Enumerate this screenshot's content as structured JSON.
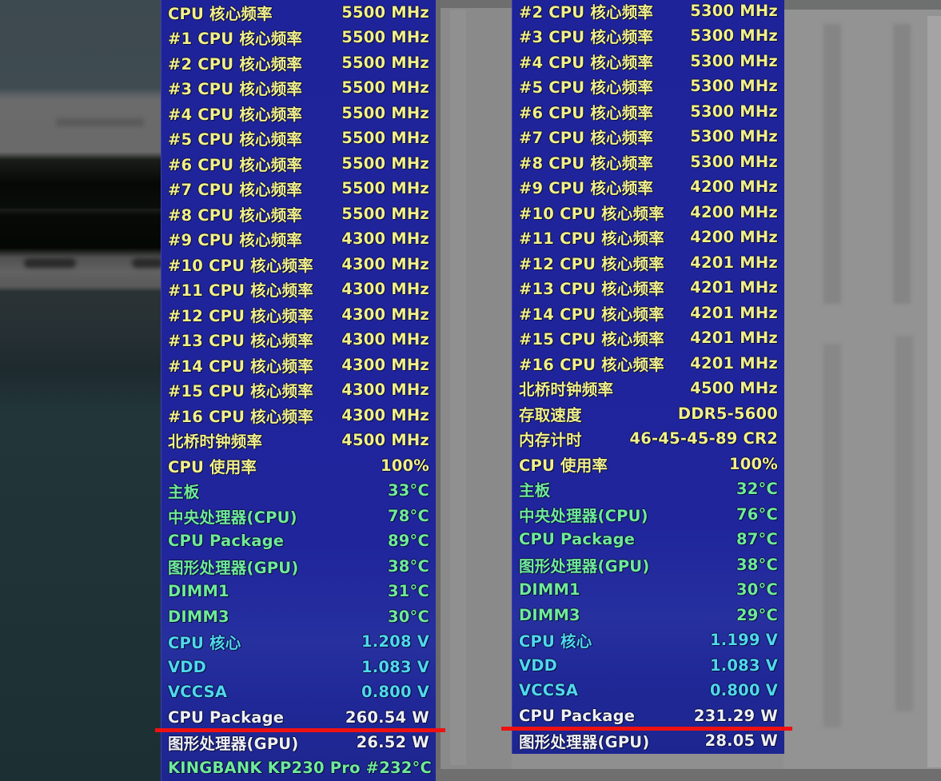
{
  "colors": {
    "panel_bg": "#1f239a",
    "frequency_text": "#f1f08a",
    "temperature_text": "#6fea9a",
    "voltage_text": "#4fd8ee",
    "power_text": "#eef0f4",
    "highlight_line": "#ee1111"
  },
  "left_panel": {
    "rows": [
      {
        "label": "CPU 核心频率",
        "value": "5500 MHz",
        "kind": "yellow"
      },
      {
        "label": "#1 CPU 核心频率",
        "value": "5500 MHz",
        "kind": "yellow"
      },
      {
        "label": "#2 CPU 核心频率",
        "value": "5500 MHz",
        "kind": "yellow"
      },
      {
        "label": "#3 CPU 核心频率",
        "value": "5500 MHz",
        "kind": "yellow"
      },
      {
        "label": "#4 CPU 核心频率",
        "value": "5500 MHz",
        "kind": "yellow"
      },
      {
        "label": "#5 CPU 核心频率",
        "value": "5500 MHz",
        "kind": "yellow"
      },
      {
        "label": "#6 CPU 核心频率",
        "value": "5500 MHz",
        "kind": "yellow"
      },
      {
        "label": "#7 CPU 核心频率",
        "value": "5500 MHz",
        "kind": "yellow"
      },
      {
        "label": "#8 CPU 核心频率",
        "value": "5500 MHz",
        "kind": "yellow"
      },
      {
        "label": "#9 CPU 核心频率",
        "value": "4300 MHz",
        "kind": "yellow"
      },
      {
        "label": "#10 CPU 核心频率",
        "value": "4300 MHz",
        "kind": "yellow"
      },
      {
        "label": "#11 CPU 核心频率",
        "value": "4300 MHz",
        "kind": "yellow"
      },
      {
        "label": "#12 CPU 核心频率",
        "value": "4300 MHz",
        "kind": "yellow"
      },
      {
        "label": "#13 CPU 核心频率",
        "value": "4300 MHz",
        "kind": "yellow"
      },
      {
        "label": "#14 CPU 核心频率",
        "value": "4300 MHz",
        "kind": "yellow"
      },
      {
        "label": "#15 CPU 核心频率",
        "value": "4300 MHz",
        "kind": "yellow"
      },
      {
        "label": "#16 CPU 核心频率",
        "value": "4300 MHz",
        "kind": "yellow"
      },
      {
        "label": "北桥时钟频率",
        "value": "4500 MHz",
        "kind": "yellow"
      },
      {
        "label": "CPU 使用率",
        "value": "100%",
        "kind": "yellow"
      },
      {
        "label": "主板",
        "value": "33°C",
        "kind": "green"
      },
      {
        "label": "中央处理器(CPU)",
        "value": "78°C",
        "kind": "green"
      },
      {
        "label": "CPU Package",
        "value": "89°C",
        "kind": "green"
      },
      {
        "label": "图形处理器(GPU)",
        "value": "38°C",
        "kind": "green"
      },
      {
        "label": "DIMM1",
        "value": "31°C",
        "kind": "green"
      },
      {
        "label": "DIMM3",
        "value": "30°C",
        "kind": "green"
      },
      {
        "label": "CPU 核心",
        "value": "1.208 V",
        "kind": "cyan"
      },
      {
        "label": "VDD",
        "value": "1.083 V",
        "kind": "cyan"
      },
      {
        "label": "VCCSA",
        "value": "0.800 V",
        "kind": "cyan"
      },
      {
        "label": "CPU Package",
        "value": "260.54 W",
        "kind": "white"
      },
      {
        "label": "图形处理器(GPU)",
        "value": "26.52 W",
        "kind": "white"
      },
      {
        "label": "KINGBANK KP230 Pro #2",
        "value": "32°C",
        "kind": "green"
      }
    ]
  },
  "right_panel": {
    "rows": [
      {
        "label": "#2 CPU 核心频率",
        "value": "5300 MHz",
        "kind": "yellow"
      },
      {
        "label": "#3 CPU 核心频率",
        "value": "5300 MHz",
        "kind": "yellow"
      },
      {
        "label": "#4 CPU 核心频率",
        "value": "5300 MHz",
        "kind": "yellow"
      },
      {
        "label": "#5 CPU 核心频率",
        "value": "5300 MHz",
        "kind": "yellow"
      },
      {
        "label": "#6 CPU 核心频率",
        "value": "5300 MHz",
        "kind": "yellow"
      },
      {
        "label": "#7 CPU 核心频率",
        "value": "5300 MHz",
        "kind": "yellow"
      },
      {
        "label": "#8 CPU 核心频率",
        "value": "5300 MHz",
        "kind": "yellow"
      },
      {
        "label": "#9 CPU 核心频率",
        "value": "4200 MHz",
        "kind": "yellow"
      },
      {
        "label": "#10 CPU 核心频率",
        "value": "4200 MHz",
        "kind": "yellow"
      },
      {
        "label": "#11 CPU 核心频率",
        "value": "4200 MHz",
        "kind": "yellow"
      },
      {
        "label": "#12 CPU 核心频率",
        "value": "4201 MHz",
        "kind": "yellow"
      },
      {
        "label": "#13 CPU 核心频率",
        "value": "4201 MHz",
        "kind": "yellow"
      },
      {
        "label": "#14 CPU 核心频率",
        "value": "4201 MHz",
        "kind": "yellow"
      },
      {
        "label": "#15 CPU 核心频率",
        "value": "4201 MHz",
        "kind": "yellow"
      },
      {
        "label": "#16 CPU 核心频率",
        "value": "4201 MHz",
        "kind": "yellow"
      },
      {
        "label": "北桥时钟频率",
        "value": "4500 MHz",
        "kind": "yellow"
      },
      {
        "label": "存取速度",
        "value": "DDR5-5600",
        "kind": "yellow"
      },
      {
        "label": "内存计时",
        "value": "46-45-45-89 CR2",
        "kind": "yellow"
      },
      {
        "label": "CPU 使用率",
        "value": "100%",
        "kind": "yellow"
      },
      {
        "label": "主板",
        "value": "32°C",
        "kind": "green"
      },
      {
        "label": "中央处理器(CPU)",
        "value": "76°C",
        "kind": "green"
      },
      {
        "label": "CPU Package",
        "value": "87°C",
        "kind": "green"
      },
      {
        "label": "图形处理器(GPU)",
        "value": "38°C",
        "kind": "green"
      },
      {
        "label": "DIMM1",
        "value": "30°C",
        "kind": "green"
      },
      {
        "label": "DIMM3",
        "value": "29°C",
        "kind": "green"
      },
      {
        "label": "CPU 核心",
        "value": "1.199 V",
        "kind": "cyan"
      },
      {
        "label": "VDD",
        "value": "1.083 V",
        "kind": "cyan"
      },
      {
        "label": "VCCSA",
        "value": "0.800 V",
        "kind": "cyan"
      },
      {
        "label": "CPU Package",
        "value": "231.29 W",
        "kind": "white"
      },
      {
        "label": "图形处理器(GPU)",
        "value": "28.05 W",
        "kind": "white"
      }
    ]
  }
}
